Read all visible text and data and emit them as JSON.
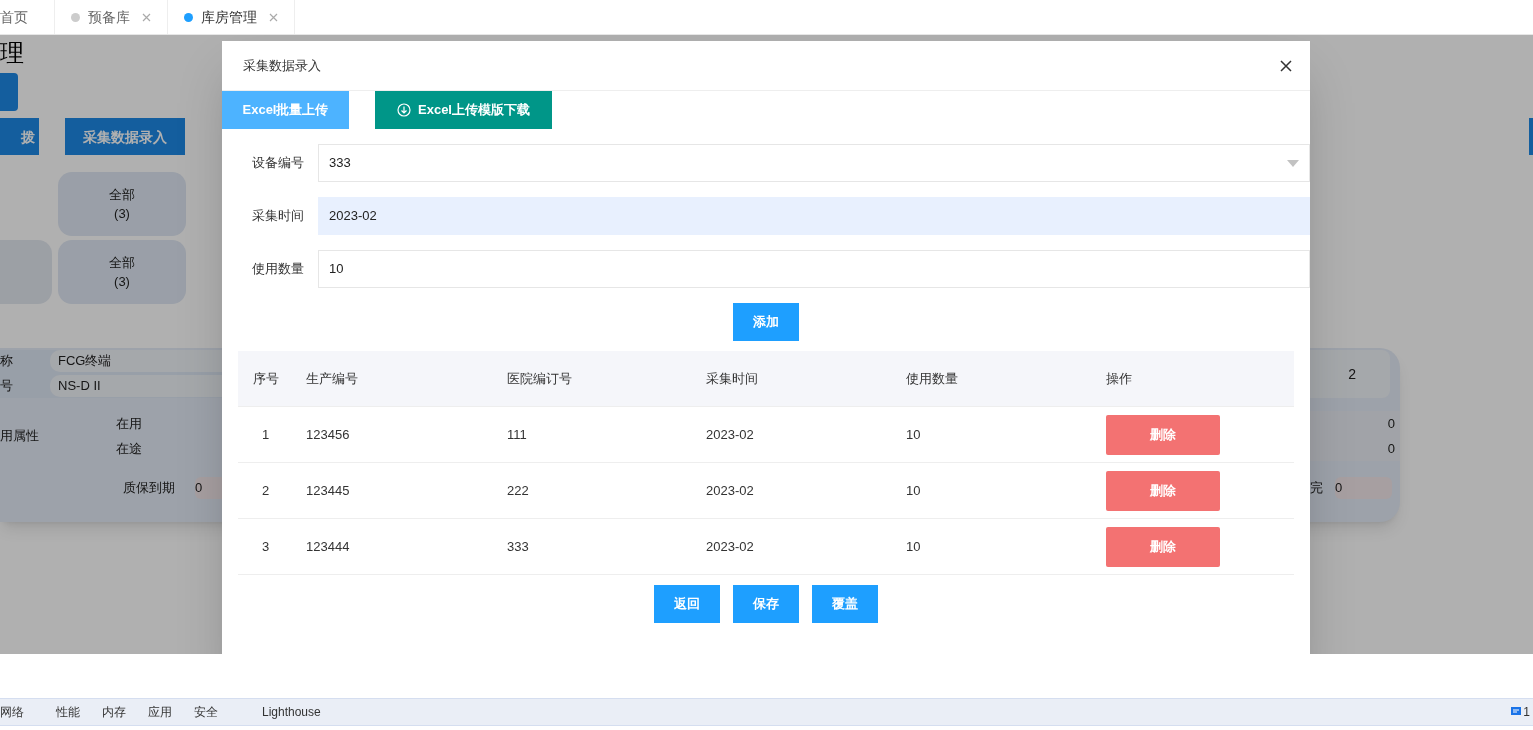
{
  "tabs": [
    {
      "label": "首页",
      "selected": false,
      "closable": false
    },
    {
      "label": "预备库",
      "selected": false,
      "closable": true
    },
    {
      "label": "库房管理",
      "selected": true,
      "closable": true
    }
  ],
  "background_page": {
    "heading": "理",
    "buttons": [
      "拨",
      "采集数据录入"
    ],
    "cards": [
      {
        "label": "全部",
        "count": "(3)"
      },
      {
        "label": "全部",
        "count": "(3)"
      }
    ],
    "info": {
      "name_label": "称",
      "name_value": "FCG终端",
      "model_label": "号",
      "model_value": "NS-D II",
      "total": "2",
      "usage_label": "用属性",
      "usage_items": [
        {
          "label": "在用",
          "value": "0"
        },
        {
          "label": "在途",
          "value": "0"
        }
      ],
      "warranty_label": "质保到期",
      "warranty_value": "0",
      "right_label": "完",
      "right_value": "0"
    }
  },
  "dialog": {
    "title": "采集数据录入",
    "upload_buttons": [
      {
        "label": "Excel批量上传",
        "kind": "upload"
      },
      {
        "label": "Excel上传模版下载",
        "kind": "download"
      }
    ],
    "fields": [
      {
        "label": "设备编号",
        "value": "333",
        "kind": "select",
        "autofilled": false
      },
      {
        "label": "采集时间",
        "value": "2023-02",
        "kind": "input",
        "autofilled": true
      },
      {
        "label": "使用数量",
        "value": "10",
        "kind": "input",
        "autofilled": false
      }
    ],
    "add_button": "添加",
    "table": {
      "columns": [
        "序号",
        "生产编号",
        "医院编订号",
        "采集时间",
        "使用数量",
        "操作"
      ],
      "rows": [
        {
          "cells": [
            "1",
            "123456",
            "111",
            "2023-02",
            "10"
          ],
          "action": "删除"
        },
        {
          "cells": [
            "2",
            "123445",
            "222",
            "2023-02",
            "10"
          ],
          "action": "删除"
        },
        {
          "cells": [
            "3",
            "123444",
            "333",
            "2023-02",
            "10"
          ],
          "action": "删除"
        }
      ]
    },
    "footer_buttons": [
      "返回",
      "保存",
      "覆盖"
    ]
  },
  "devtools": {
    "tabs": [
      "网络",
      "性能",
      "内存",
      "应用",
      "安全",
      "Lighthouse"
    ],
    "issues_count": "1"
  }
}
